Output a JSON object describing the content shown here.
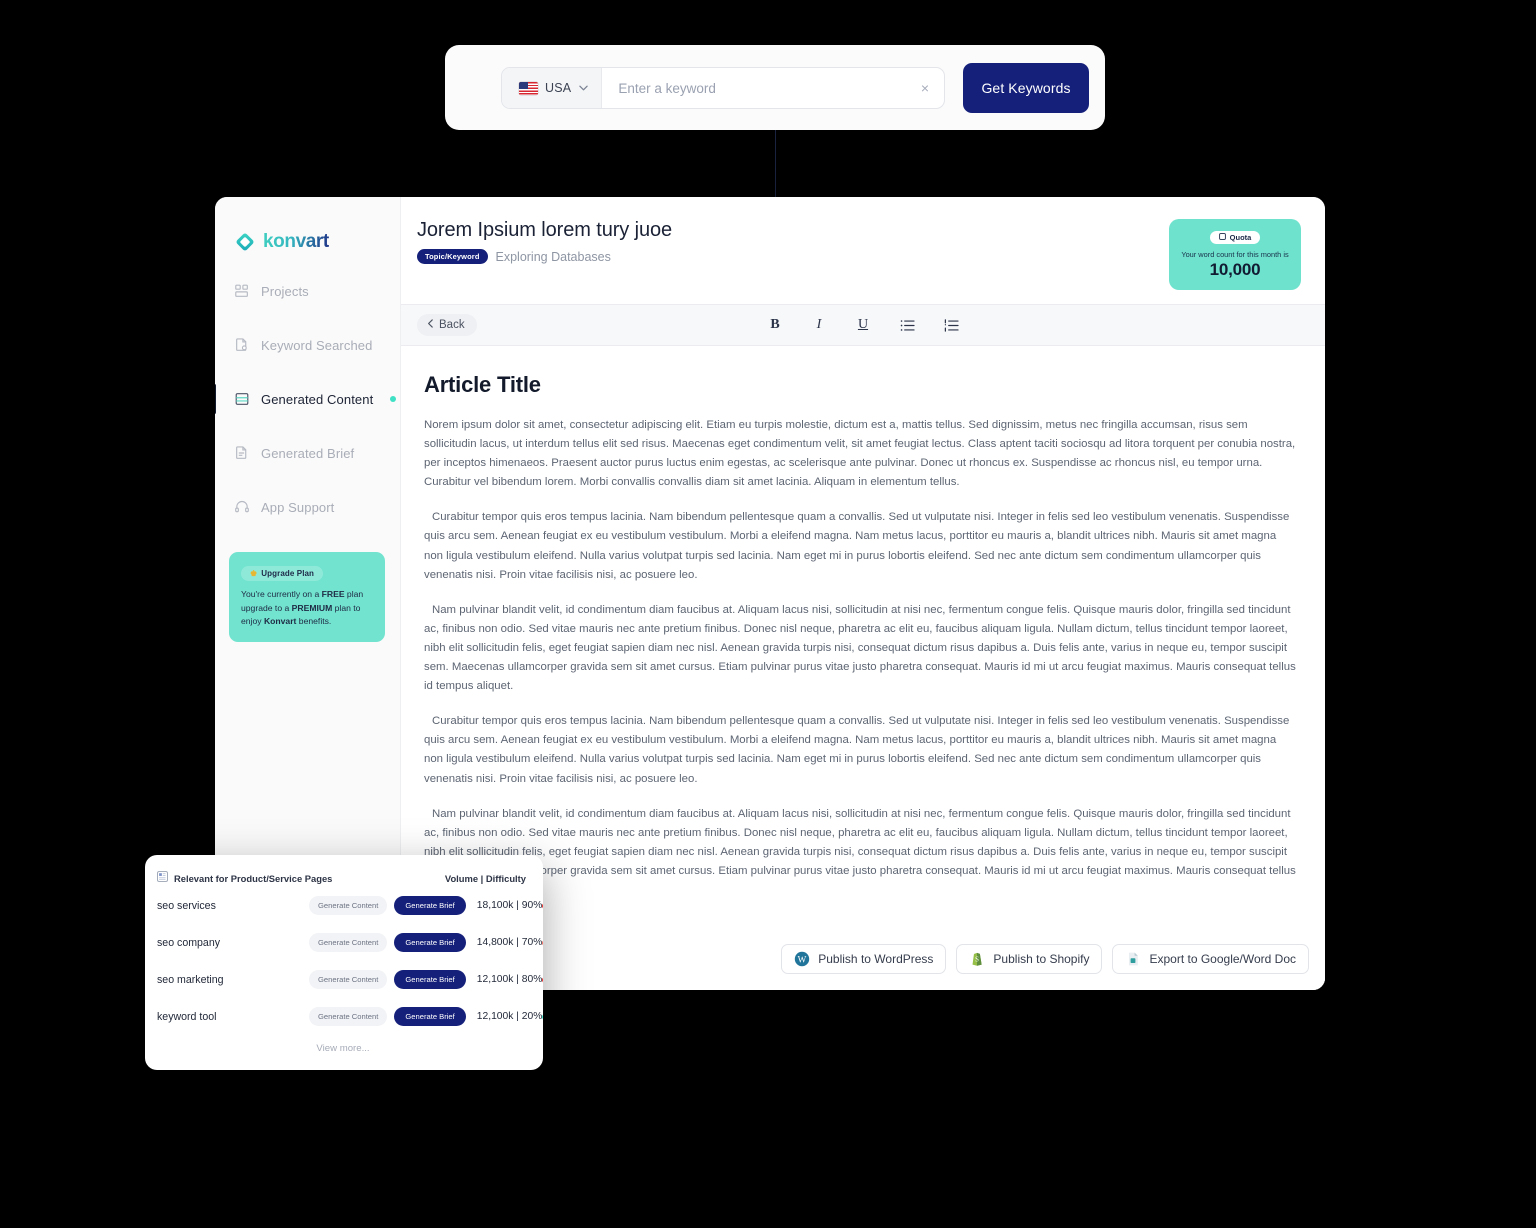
{
  "search": {
    "country": "USA",
    "placeholder": "Enter a keyword",
    "value": "",
    "clear_label": "×",
    "button_label": "Get Keywords",
    "caret": "⌄"
  },
  "sidebar": {
    "brand": "konvart",
    "items": [
      {
        "label": "Projects",
        "icon": "grid-icon",
        "active": false,
        "dot": false
      },
      {
        "label": "Keyword Searched",
        "icon": "file-search-icon",
        "active": false,
        "dot": false
      },
      {
        "label": "Generated Content",
        "icon": "document-lines-icon",
        "active": true,
        "dot": true
      },
      {
        "label": "Generated Brief",
        "icon": "file-icon",
        "active": false,
        "dot": false
      },
      {
        "label": "App Support",
        "icon": "headset-icon",
        "active": false,
        "dot": false
      }
    ],
    "upgrade": {
      "badge": "Upgrade Plan",
      "badge_icon": "crown-icon",
      "line1_a": "You're currently on a ",
      "line1_b": "FREE",
      "line1_c": " plan upgrade to a ",
      "line1_d": "PREMIUM",
      "line1_e": " plan to enjoy ",
      "line1_f": "Konvart",
      "line1_g": " benefits."
    }
  },
  "header": {
    "title": "Jorem Ipsium lorem tury juoe",
    "tag": "Topic/Keyword",
    "subtitle": "Exploring Databases"
  },
  "quota": {
    "badge": "Quota",
    "badge_icon": "square-icon",
    "caption": "Your word count for this month is",
    "value": "10,000"
  },
  "toolbar": {
    "back_label": "Back",
    "back_icon": "chevron-left-icon",
    "tools": [
      {
        "name": "bold-icon",
        "glyph": "B"
      },
      {
        "name": "italic-icon",
        "glyph": "I"
      },
      {
        "name": "underline-icon",
        "glyph": "U"
      },
      {
        "name": "bullet-list-icon",
        "glyph": "≡"
      },
      {
        "name": "numbered-list-icon",
        "glyph": "≡"
      }
    ]
  },
  "document": {
    "title": "Article Title",
    "paragraphs": [
      "Norem ipsum dolor sit amet, consectetur adipiscing elit. Etiam eu turpis molestie, dictum est a, mattis tellus. Sed dignissim, metus nec fringilla accumsan, risus sem sollicitudin lacus, ut interdum tellus elit sed risus. Maecenas eget condimentum velit, sit amet feugiat lectus. Class aptent taciti sociosqu ad litora torquent per conubia nostra, per inceptos himenaeos. Praesent auctor purus luctus enim egestas, ac scelerisque ante pulvinar. Donec ut rhoncus ex. Suspendisse ac rhoncus nisl, eu tempor urna. Curabitur vel bibendum lorem. Morbi convallis convallis diam sit amet lacinia. Aliquam in elementum tellus.",
      "Curabitur tempor quis eros tempus lacinia. Nam bibendum pellentesque quam a convallis. Sed ut vulputate nisi. Integer in felis sed leo vestibulum venenatis. Suspendisse quis arcu sem. Aenean feugiat ex eu vestibulum vestibulum. Morbi a eleifend magna. Nam metus lacus, porttitor eu mauris a, blandit ultrices nibh. Mauris sit amet magna non ligula vestibulum eleifend. Nulla varius volutpat turpis sed lacinia. Nam eget mi in purus lobortis eleifend. Sed nec ante dictum sem condimentum ullamcorper quis venenatis nisi. Proin vitae facilisis nisi, ac posuere leo.",
      "Nam pulvinar blandit velit, id condimentum diam faucibus at. Aliquam lacus nisi, sollicitudin at nisi nec, fermentum congue felis. Quisque mauris dolor, fringilla sed tincidunt ac, finibus non odio. Sed vitae mauris nec ante pretium finibus. Donec nisl neque, pharetra ac elit eu, faucibus aliquam ligula. Nullam dictum, tellus tincidunt tempor laoreet, nibh elit sollicitudin felis, eget feugiat sapien diam nec nisl. Aenean gravida turpis nisi, consequat dictum risus dapibus a. Duis felis ante, varius in neque eu, tempor suscipit sem. Maecenas ullamcorper gravida sem sit amet cursus. Etiam pulvinar purus vitae justo pharetra consequat. Mauris id mi ut arcu feugiat maximus. Mauris consequat tellus id tempus aliquet.",
      "Curabitur tempor quis eros tempus lacinia. Nam bibendum pellentesque quam a convallis. Sed ut vulputate nisi. Integer in felis sed leo vestibulum venenatis. Suspendisse quis arcu sem. Aenean feugiat ex eu vestibulum vestibulum. Morbi a eleifend magna. Nam metus lacus, porttitor eu mauris a, blandit ultrices nibh. Mauris sit amet magna non ligula vestibulum eleifend. Nulla varius volutpat turpis sed lacinia. Nam eget mi in purus lobortis eleifend. Sed nec ante dictum sem condimentum ullamcorper quis venenatis nisi. Proin vitae facilisis nisi, ac posuere leo.",
      "Nam pulvinar blandit velit, id condimentum diam faucibus at. Aliquam lacus nisi, sollicitudin at nisi nec, fermentum congue felis. Quisque mauris dolor, fringilla sed tincidunt ac, finibus non odio. Sed vitae mauris nec ante pretium finibus. Donec nisl neque, pharetra ac elit eu, faucibus aliquam ligula. Nullam dictum, tellus tincidunt tempor laoreet, nibh elit sollicitudin felis, eget feugiat sapien diam nec nisl. Aenean gravida turpis nisi, consequat dictum risus dapibus a. Duis felis ante, varius in neque eu, tempor suscipit sem. Maecenas ullamcorper gravida sem sit amet cursus. Etiam pulvinar purus vitae justo pharetra consequat. Mauris id mi ut arcu feugiat maximus. Mauris consequat tellus id tempus aliquet."
    ]
  },
  "footer": {
    "buttons": [
      {
        "label": "Publish to WordPress",
        "icon": "wordpress-icon"
      },
      {
        "label": "Publish to Shopify",
        "icon": "shopify-icon"
      },
      {
        "label": "Export to Google/Word Doc",
        "icon": "document-export-icon"
      }
    ]
  },
  "keyword_panel": {
    "header_icon": "table-icon",
    "header_title": "Relevant for Product/Service Pages",
    "header_metric": "Volume | Difficulty",
    "generate_content_label": "Generate Content",
    "generate_brief_label": "Generate Brief",
    "view_more": "View more...",
    "rows": [
      {
        "keyword": "seo services",
        "metric": "18,100k | 90%",
        "difficulty_color": "#ef2b2b"
      },
      {
        "keyword": "seo company",
        "metric": "14,800k | 70%",
        "difficulty_color": "#f06a60"
      },
      {
        "keyword": "seo marketing",
        "metric": "12,100k | 80%",
        "difficulty_color": "#ef2b2b"
      },
      {
        "keyword": "keyword tool",
        "metric": "12,100k | 20%",
        "difficulty_color": "#36dfc2"
      }
    ]
  },
  "colors": {
    "brand_navy": "#15207a",
    "brand_teal": "#6fe2cd",
    "accent_dot": "#3fe0c4"
  }
}
